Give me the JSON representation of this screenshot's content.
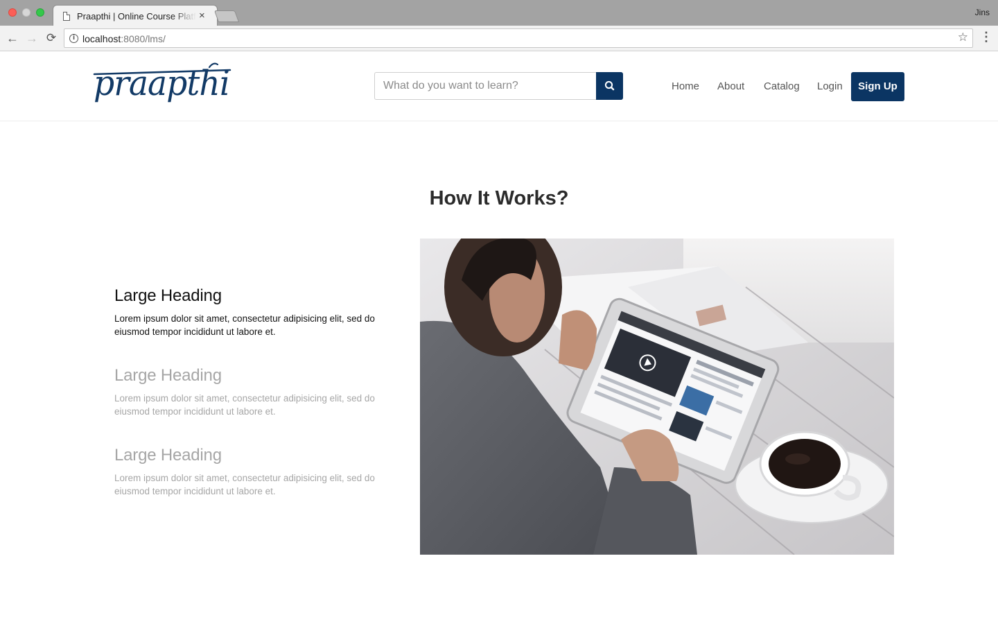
{
  "browser": {
    "tab_title": "Praapthi | Online Course Platform",
    "tab_close": "×",
    "profile": "Jins",
    "url_host": "localhost",
    "url_rest": ":8080/lms/",
    "icons": {
      "back": "←",
      "forward": "→",
      "reload": "⟳",
      "info": "i",
      "bookmark": "☆",
      "menu": "⋮"
    }
  },
  "header": {
    "logo_text": "praapthi",
    "search_placeholder": "What do you want to learn?",
    "nav": [
      {
        "label": "Home"
      },
      {
        "label": "About"
      },
      {
        "label": "Catalog"
      },
      {
        "label": "Login"
      }
    ],
    "signup_label": "Sign Up",
    "brand_color": "#0b3563"
  },
  "main": {
    "title": "How It Works?",
    "steps": [
      {
        "heading": "Large Heading",
        "text": "Lorem ipsum dolor sit amet, consectetur adipisicing elit, sed do eiusmod tempor incididunt ut labore et.",
        "active": true
      },
      {
        "heading": "Large Heading",
        "text": "Lorem ipsum dolor sit amet, consectetur adipisicing elit, sed do eiusmod tempor incididunt ut labore et.",
        "active": false
      },
      {
        "heading": "Large Heading",
        "text": "Lorem ipsum dolor sit amet, consectetur adipisicing elit, sed do eiusmod tempor incididunt ut labore et.",
        "active": false
      }
    ]
  }
}
